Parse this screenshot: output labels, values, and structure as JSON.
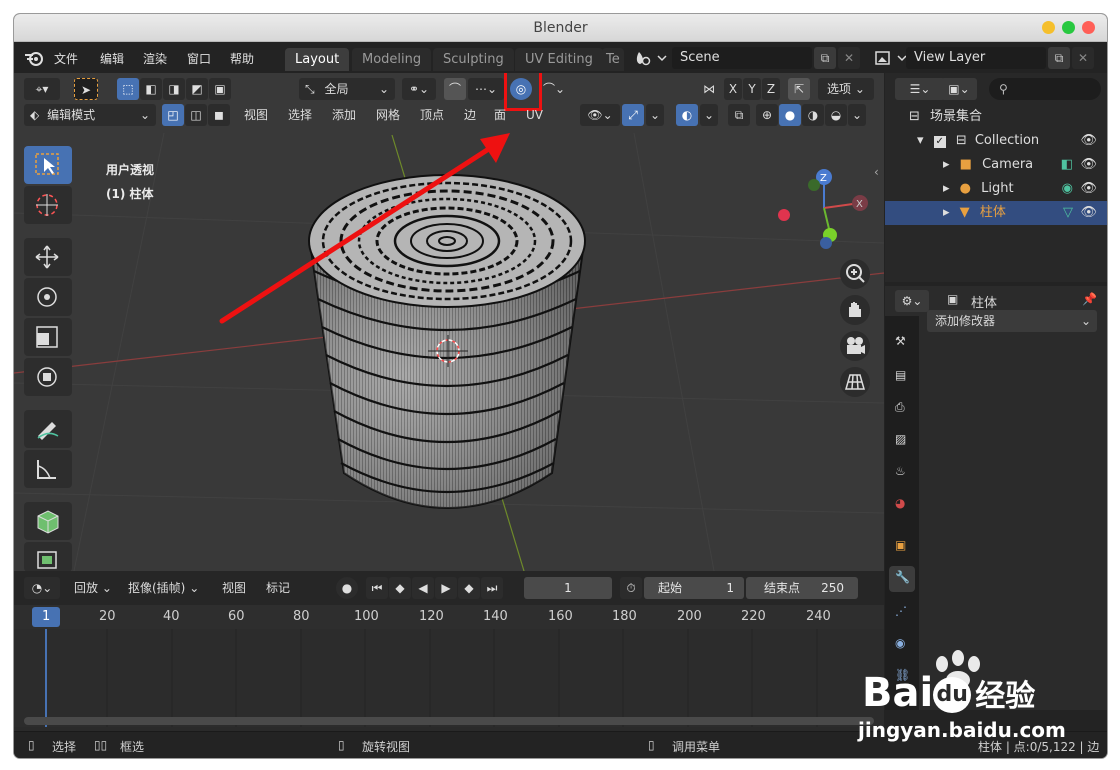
{
  "window": {
    "title": "Blender"
  },
  "topbar": {
    "menus": [
      "文件",
      "编辑",
      "渲染",
      "窗口",
      "帮助"
    ],
    "workspace_tabs": [
      "Layout",
      "Modeling",
      "Sculpting",
      "UV Editing",
      "Te"
    ],
    "scene_name": "Scene",
    "view_layer": "View Layer"
  },
  "viewport": {
    "transform_orientation": "全局",
    "options_label": "选项",
    "axis_labels": [
      "X",
      "Y",
      "Z"
    ],
    "mode": "编辑模式",
    "menus": [
      "视图",
      "选择",
      "添加",
      "网格",
      "顶点",
      "边",
      "面",
      "UV"
    ],
    "perspective_label": "用户透视",
    "object_label": "(1) 柱体",
    "gizmo_axis": "Z"
  },
  "outliner": {
    "root": "场景集合",
    "collection": "Collection",
    "items": [
      "Camera",
      "Light",
      "柱体"
    ]
  },
  "properties": {
    "object_name": "柱体",
    "add_modifier": "添加修改器"
  },
  "timeline": {
    "menus": [
      "回放",
      "抠像(插帧)",
      "视图",
      "标记"
    ],
    "current_frame": "1",
    "start_label": "起始",
    "start_value": "1",
    "end_label": "结束点",
    "end_value": "250",
    "ruler_marks": [
      "1",
      "20",
      "40",
      "60",
      "80",
      "100",
      "120",
      "140",
      "160",
      "180",
      "200",
      "220",
      "240"
    ]
  },
  "statusbar": {
    "select": "选择",
    "box_select": "框选",
    "rotate_view": "旋转视图",
    "call_menu": "调用菜单",
    "stats": "柱体 | 点:0/5,122 | 边"
  },
  "watermark": {
    "brand_a": "Bai",
    "brand_b": "du",
    "brand_c": "经验",
    "url": "jingyan.baidu.com"
  },
  "colors": {
    "accent": "#4772b3",
    "highlight_box": "#ee1111",
    "selected_row": "#334d80",
    "object_orange": "#e8a040"
  }
}
